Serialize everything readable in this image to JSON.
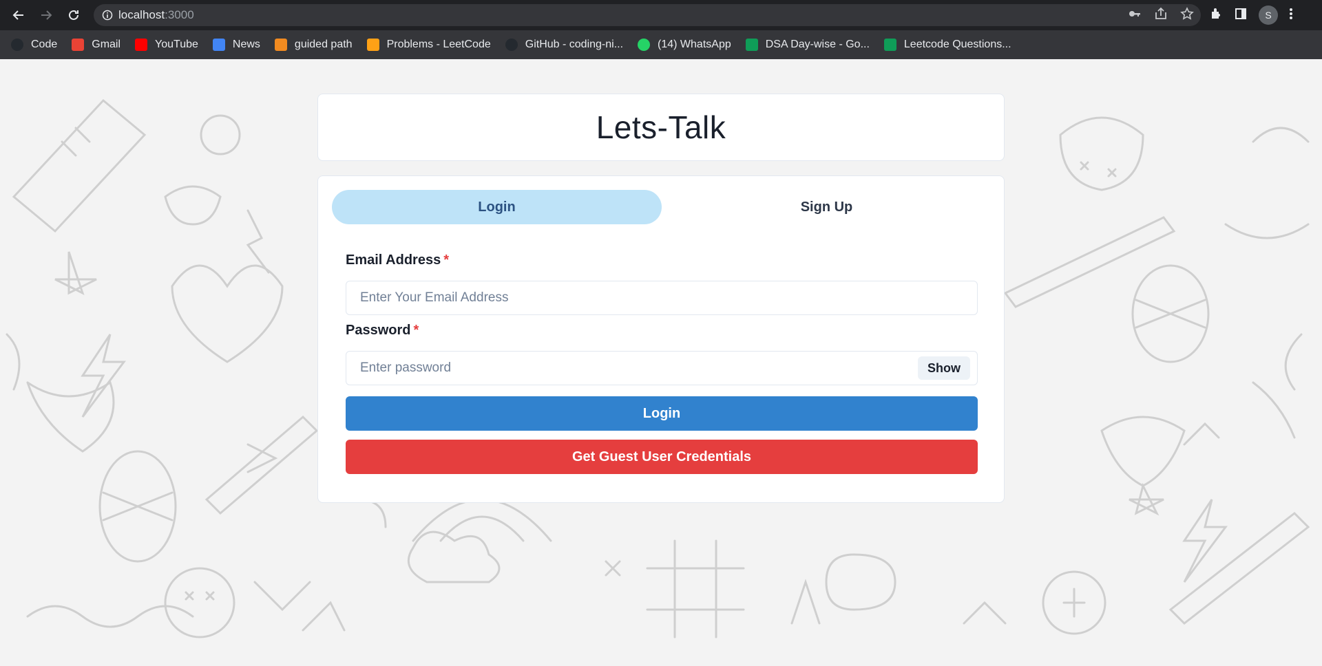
{
  "browser": {
    "url_host": "localhost",
    "url_port": ":3000",
    "profile_initial": "S",
    "bookmarks": [
      {
        "label": "Code",
        "color": "#24292f",
        "icon": "github-icon"
      },
      {
        "label": "Gmail",
        "color": "#ea4335",
        "icon": "gmail-icon"
      },
      {
        "label": "YouTube",
        "color": "#ff0000",
        "icon": "youtube-icon"
      },
      {
        "label": "News",
        "color": "#4285f4",
        "icon": "news-icon"
      },
      {
        "label": "guided path",
        "color": "#f28b20",
        "icon": "codingninjas-icon"
      },
      {
        "label": "Problems - LeetCode",
        "color": "#ffa116",
        "icon": "leetcode-icon"
      },
      {
        "label": "GitHub - coding-ni...",
        "color": "#24292f",
        "icon": "github-icon"
      },
      {
        "label": "(14) WhatsApp",
        "color": "#25d366",
        "icon": "whatsapp-icon"
      },
      {
        "label": "DSA Day-wise - Go...",
        "color": "#0f9d58",
        "icon": "sheets-icon"
      },
      {
        "label": "Leetcode Questions...",
        "color": "#0f9d58",
        "icon": "sheets-icon"
      }
    ]
  },
  "app": {
    "title": "Lets-Talk",
    "tabs": {
      "login": "Login",
      "signup": "Sign Up"
    },
    "email": {
      "label": "Email Address",
      "required": "*",
      "placeholder": "Enter Your Email Address"
    },
    "password": {
      "label": "Password",
      "required": "*",
      "placeholder": "Enter password",
      "toggle": "Show"
    },
    "login_button": "Login",
    "guest_button": "Get Guest User Credentials"
  }
}
